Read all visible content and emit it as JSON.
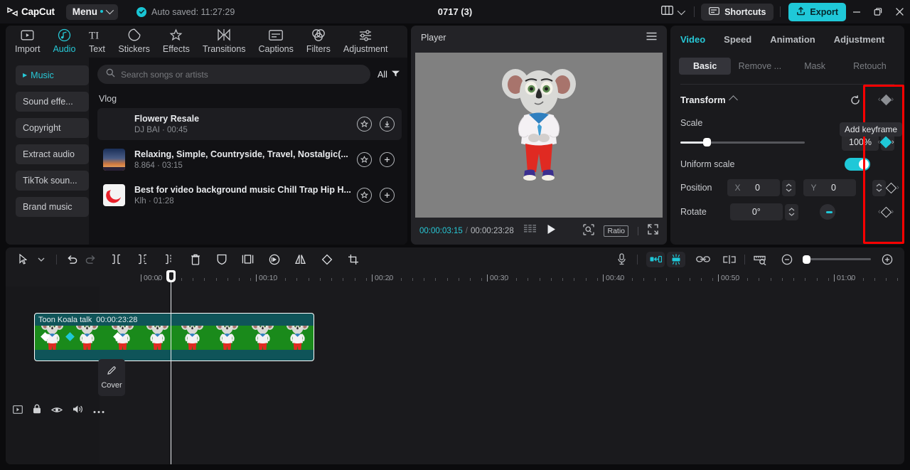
{
  "titlebar": {
    "brand": "CapCut",
    "brand_icon": "capcut-logo-icon",
    "menu_label": "Menu",
    "autosave_text": "Auto saved: 11:27:29",
    "autosave_icon": "check-circle-icon",
    "doc_title": "0717 (3)",
    "layout_icon": "layout-panels-icon",
    "shortcuts_label": "Shortcuts",
    "shortcuts_icon": "keyboard-icon",
    "export_label": "Export",
    "export_icon": "upload-icon",
    "minimize_icon": "minimize-icon",
    "maximize_icon": "restore-icon",
    "close_icon": "close-icon",
    "accent": "#1fc8d8"
  },
  "nav_tabs": [
    {
      "label": "Import",
      "icon": "import-media-icon",
      "active": false
    },
    {
      "label": "Audio",
      "icon": "music-note-icon",
      "active": true
    },
    {
      "label": "Text",
      "icon": "text-ti-icon",
      "active": false
    },
    {
      "label": "Stickers",
      "icon": "sticker-circle-icon",
      "active": false
    },
    {
      "label": "Effects",
      "icon": "sparkle-star-icon",
      "active": false
    },
    {
      "label": "Transitions",
      "icon": "transition-bowtie-icon",
      "active": false
    },
    {
      "label": "Captions",
      "icon": "captions-box-icon",
      "active": false
    },
    {
      "label": "Filters",
      "icon": "filters-circles-icon",
      "active": false
    },
    {
      "label": "Adjustment",
      "icon": "sliders-icon",
      "active": false
    }
  ],
  "audio_sidebar": {
    "items": [
      {
        "label": "Music",
        "active": true
      },
      {
        "label": "Sound effe...",
        "active": false
      },
      {
        "label": "Copyright",
        "active": false
      },
      {
        "label": "Extract audio",
        "active": false
      },
      {
        "label": "TikTok soun...",
        "active": false
      },
      {
        "label": "Brand music",
        "active": false
      }
    ]
  },
  "music_panel": {
    "search_placeholder": "Search songs or artists",
    "search_value": "",
    "search_icon": "search-icon",
    "filter_label": "All",
    "filter_icon": "filter-funnel-icon",
    "section_label": "Vlog",
    "songs": [
      {
        "name": "Flowery Resale",
        "meta": "DJ BAI · 00:45",
        "favorite_icon": "star-icon",
        "action_icon": "download-icon",
        "thumb": "none",
        "selected": true
      },
      {
        "name": "Relaxing, Simple, Countryside, Travel, Nostalgic(...",
        "meta": "8.864 · 03:15",
        "favorite_icon": "star-icon",
        "action_icon": "plus-icon",
        "thumb": "sunset-sky",
        "selected": false
      },
      {
        "name": "Best for video background music Chill Trap Hip H...",
        "meta": "Klh · 01:28",
        "favorite_icon": "star-icon",
        "action_icon": "plus-icon",
        "thumb": "red-crescent",
        "selected": false
      }
    ]
  },
  "player": {
    "title": "Player",
    "menu_icon": "hamburger-icon",
    "current_time": "00:00:03:15",
    "time_separator": "/",
    "total_time": "00:00:23:28",
    "frames_icon": "frames-icon",
    "play_icon": "play-icon",
    "magnify_icon": "zoom-target-icon",
    "ratio_label": "Ratio",
    "fullscreen_icon": "fullscreen-icon",
    "stage_bg": "#808080"
  },
  "right_panel": {
    "tabs": [
      {
        "label": "Video",
        "active": true
      },
      {
        "label": "Speed",
        "active": false
      },
      {
        "label": "Animation",
        "active": false
      },
      {
        "label": "Adjustment",
        "active": false
      }
    ],
    "subtabs": [
      {
        "label": "Basic",
        "active": true
      },
      {
        "label": "Remove ...",
        "active": false
      },
      {
        "label": "Mask",
        "active": false
      },
      {
        "label": "Retouch",
        "active": false
      }
    ],
    "transform": {
      "title": "Transform",
      "reset_icon": "reset-circular-arrow-icon",
      "keyframe_icon": "keyframe-diamond-icon",
      "scale": {
        "label": "Scale",
        "value": "100%",
        "slider_percent": 18
      },
      "uniform_scale": {
        "label": "Uniform scale",
        "enabled": true
      },
      "position": {
        "label": "Position",
        "x_axis": "X",
        "x_value": "0",
        "y_axis": "Y",
        "y_value": "0"
      },
      "rotate": {
        "label": "Rotate",
        "value": "0°"
      }
    },
    "tooltip": "Add keyframe",
    "highlight_color": "#fe0000"
  },
  "timeline": {
    "tools_left": [
      {
        "icon": "select-arrow-icon"
      },
      {
        "icon": "chevron-down-icon"
      },
      {
        "icon": "undo-icon"
      },
      {
        "icon": "redo-icon"
      },
      {
        "icon": "split-left-icon"
      },
      {
        "icon": "split-right-icon"
      },
      {
        "icon": "split-icon"
      },
      {
        "icon": "delete-trash-icon"
      },
      {
        "icon": "mask-shield-icon"
      },
      {
        "icon": "freeze-frame-icon"
      },
      {
        "icon": "reverse-icon"
      },
      {
        "icon": "mirror-icon"
      },
      {
        "icon": "rotate-icon"
      },
      {
        "icon": "crop-icon"
      }
    ],
    "tools_right": [
      {
        "icon": "microphone-icon",
        "active": false
      },
      {
        "icon": "auto-fit-icon",
        "active": true
      },
      {
        "icon": "snap-magnet-icon",
        "active": true
      },
      {
        "icon": "link-icon",
        "active": false
      },
      {
        "icon": "split-clip-icon",
        "active": false
      },
      {
        "icon": "ruler-zoom-icon",
        "active": false
      }
    ],
    "zoom_out_icon": "zoom-out-icon",
    "zoom_in_icon": "zoom-in-icon",
    "zoom_value_percent": 3,
    "ruler_labels": [
      "00:00",
      "00:10",
      "00:20",
      "00:30",
      "00:40",
      "00:50",
      "01:00"
    ],
    "gutter_icons": [
      {
        "icon": "track-thumbnail-icon"
      },
      {
        "icon": "lock-icon"
      },
      {
        "icon": "eye-icon"
      },
      {
        "icon": "volume-icon"
      },
      {
        "icon": "more-dots-icon"
      }
    ],
    "cover": {
      "label": "Cover",
      "icon": "pencil-icon"
    },
    "clip": {
      "name": "Toon Koala talk",
      "duration": "00:00:23:28",
      "keyframes": [
        {
          "position_percent": 2.5,
          "color": "#ffffff"
        },
        {
          "position_percent": 11.5,
          "color": "#1fc8d8"
        },
        {
          "position_percent": 28.5,
          "color": "#ffffff"
        }
      ],
      "track_color": "#1a8a1b",
      "header_color": "#0f5459"
    }
  }
}
